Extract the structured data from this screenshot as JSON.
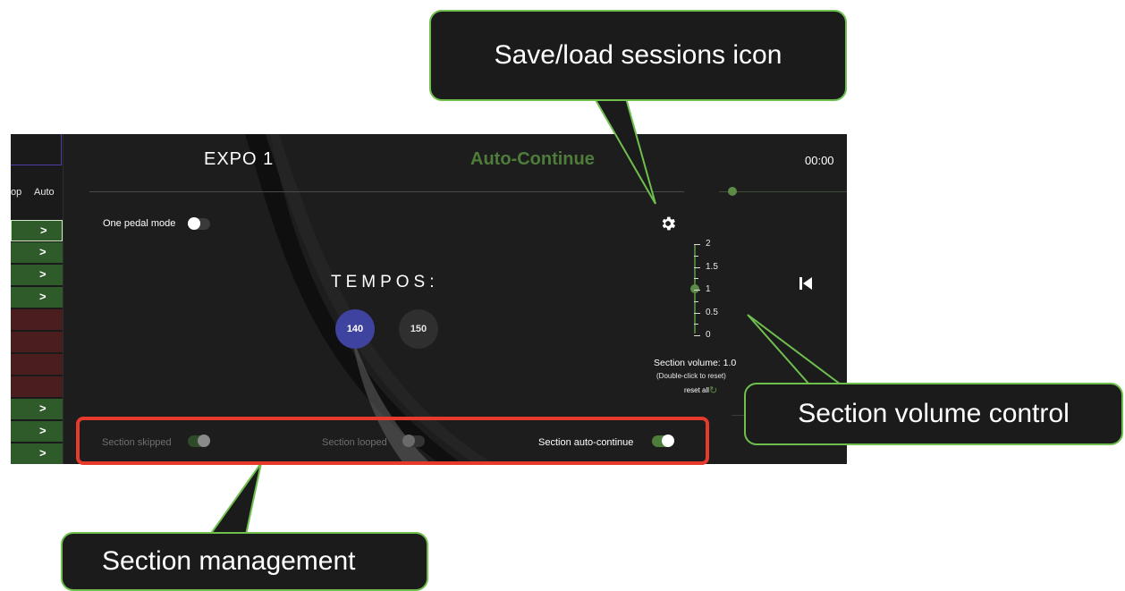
{
  "app": {
    "title": "EXPO 1",
    "status": "Auto-Continue",
    "time": "00:00",
    "one_pedal_label": "One pedal mode",
    "tempos_heading": "TEMPOS:",
    "tempos": [
      "140",
      "150"
    ],
    "selected_tempo": "140",
    "volume": {
      "ticks": [
        "2",
        "1.5",
        "1",
        "0.5",
        "0"
      ],
      "current": 1.0,
      "label": "Section volume: 1.0",
      "hint": "(Double-click to reset)",
      "reset_label": "reset all"
    },
    "sidebar": {
      "headers": [
        "op",
        "Auto"
      ],
      "rows": [
        {
          "color": "green",
          "chevron": ">",
          "selected": true
        },
        {
          "color": "green",
          "chevron": ">"
        },
        {
          "color": "green",
          "chevron": ">"
        },
        {
          "color": "green",
          "chevron": ">"
        },
        {
          "color": "red",
          "chevron": ""
        },
        {
          "color": "red",
          "chevron": ""
        },
        {
          "color": "red",
          "chevron": ""
        },
        {
          "color": "red",
          "chevron": ""
        },
        {
          "color": "green",
          "chevron": ">"
        },
        {
          "color": "green",
          "chevron": ">"
        },
        {
          "color": "green",
          "chevron": ">"
        }
      ]
    },
    "section_toggles": [
      {
        "label": "Section skipped",
        "on": true,
        "enabled": false
      },
      {
        "label": "Section looped",
        "on": false,
        "enabled": false
      },
      {
        "label": "Section auto-continue",
        "on": true,
        "enabled": true
      }
    ],
    "icons": [
      "gear-icon",
      "skip-back-icon",
      "refresh-icon"
    ]
  },
  "annotations": {
    "save_load": "Save/load sessions icon",
    "volume_control": "Section volume control",
    "management": "Section management"
  },
  "colors": {
    "accent_green": "#4e7c3a",
    "tempo_selected": "#3f43a0",
    "callout_border": "#6fbf4f",
    "highlight_red": "#e53a2c"
  }
}
